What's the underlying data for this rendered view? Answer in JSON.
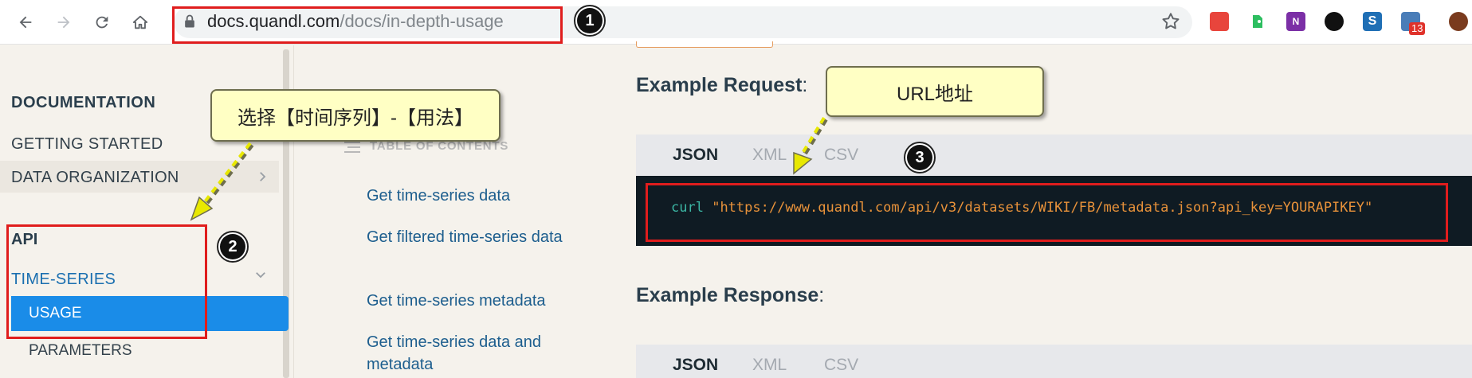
{
  "browser": {
    "url_host": "docs.quandl.com",
    "url_path": "/docs/in-depth-usage",
    "ext_badge_count": "13"
  },
  "sidebar": {
    "heading": "DOCUMENTATION",
    "items": [
      {
        "label": "GETTING STARTED"
      },
      {
        "label": "DATA ORGANIZATION"
      }
    ],
    "api_label": "API",
    "section_label": "TIME-SERIES",
    "active_item": "USAGE",
    "next_item": "PARAMETERS"
  },
  "toc": {
    "title": "TABLE OF CONTENTS",
    "links": [
      {
        "label": "Get time-series data"
      },
      {
        "label": "Get filtered time-series data"
      },
      {
        "label": "Get time-series metadata"
      },
      {
        "label": "Get time-series data and metadata"
      }
    ]
  },
  "main": {
    "request_title": "Example Request",
    "request_colon": ":",
    "response_title": "Example Response",
    "response_colon": ":",
    "tabs": [
      {
        "label": "JSON",
        "active": true
      },
      {
        "label": "XML",
        "active": false
      },
      {
        "label": "CSV",
        "active": false
      }
    ],
    "code_cmd": "curl",
    "code_url": "\"https://www.quandl.com/api/v3/datasets/WIKI/FB/metadata.json?api_key=YOURAPIKEY\""
  },
  "annotations": {
    "badge1": "1",
    "badge2": "2",
    "badge3": "3",
    "callout_sidebar": "选择【时间序列】-【用法】",
    "callout_url": "URL地址"
  },
  "colors": {
    "annotation_red": "#e01d1d",
    "callout_fill": "#ffffc4",
    "active_blue": "#1a8ce8",
    "code_bg": "#0f1b23"
  },
  "icons": [
    "back-icon",
    "forward-icon",
    "reload-icon",
    "home-icon",
    "lock-icon",
    "star-icon",
    "toc-icon",
    "chevron-right-icon",
    "chevron-down-icon"
  ]
}
